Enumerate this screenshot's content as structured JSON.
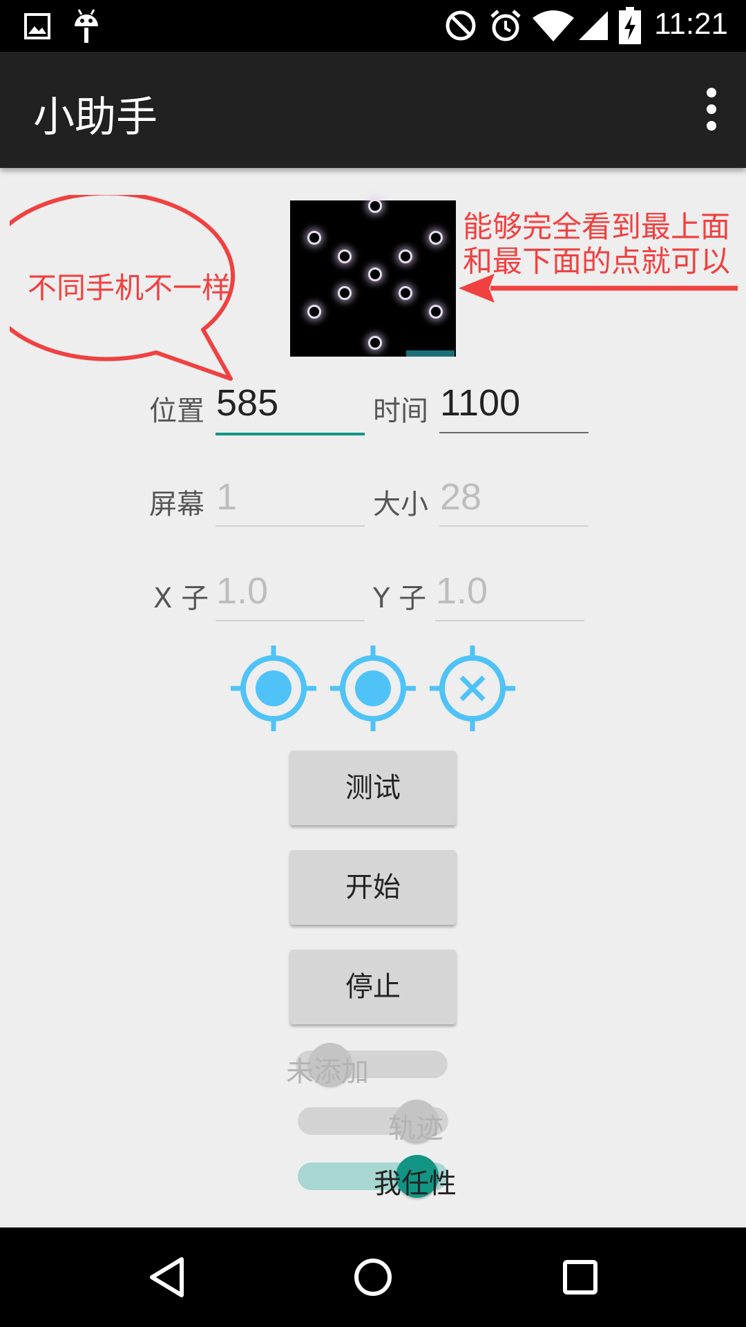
{
  "status_bar": {
    "time": "11:21",
    "icons": [
      "image-icon",
      "android-icon",
      "do-not-disturb-icon",
      "alarm-icon",
      "wifi-icon",
      "signal-icon",
      "battery-charging-icon"
    ]
  },
  "app_bar": {
    "title": "小助手",
    "menu_icon": "overflow-menu-icon"
  },
  "annotation": {
    "bubble_text": "不同手机不一样",
    "note_line1": "能够完全看到最上面",
    "note_line2": "和最下面的点就可以",
    "color": "#f04141"
  },
  "form": {
    "position": {
      "label": "位置",
      "value": "585"
    },
    "time": {
      "label": "时间",
      "value": "1100"
    },
    "screen": {
      "label": "屏幕",
      "hint": "1"
    },
    "size": {
      "label": "大小",
      "hint": "28"
    },
    "x_factor": {
      "label": "X 子",
      "hint": "1.0"
    },
    "y_factor": {
      "label": "Y 子",
      "hint": "1.0"
    }
  },
  "targets": [
    "crosshair-filled-icon",
    "crosshair-filled-icon",
    "crosshair-x-icon"
  ],
  "buttons": {
    "test": "测试",
    "start": "开始",
    "stop": "停止"
  },
  "switches": [
    {
      "label": "未添加",
      "checked": false
    },
    {
      "label": "轨迹",
      "checked": false
    },
    {
      "label": "我任性",
      "checked": true
    }
  ],
  "colors": {
    "accent": "#129585",
    "crosshair": "#4fc3f7",
    "app_bar": "#212121"
  },
  "nav_bar": [
    "back-icon",
    "home-icon",
    "recents-icon"
  ]
}
